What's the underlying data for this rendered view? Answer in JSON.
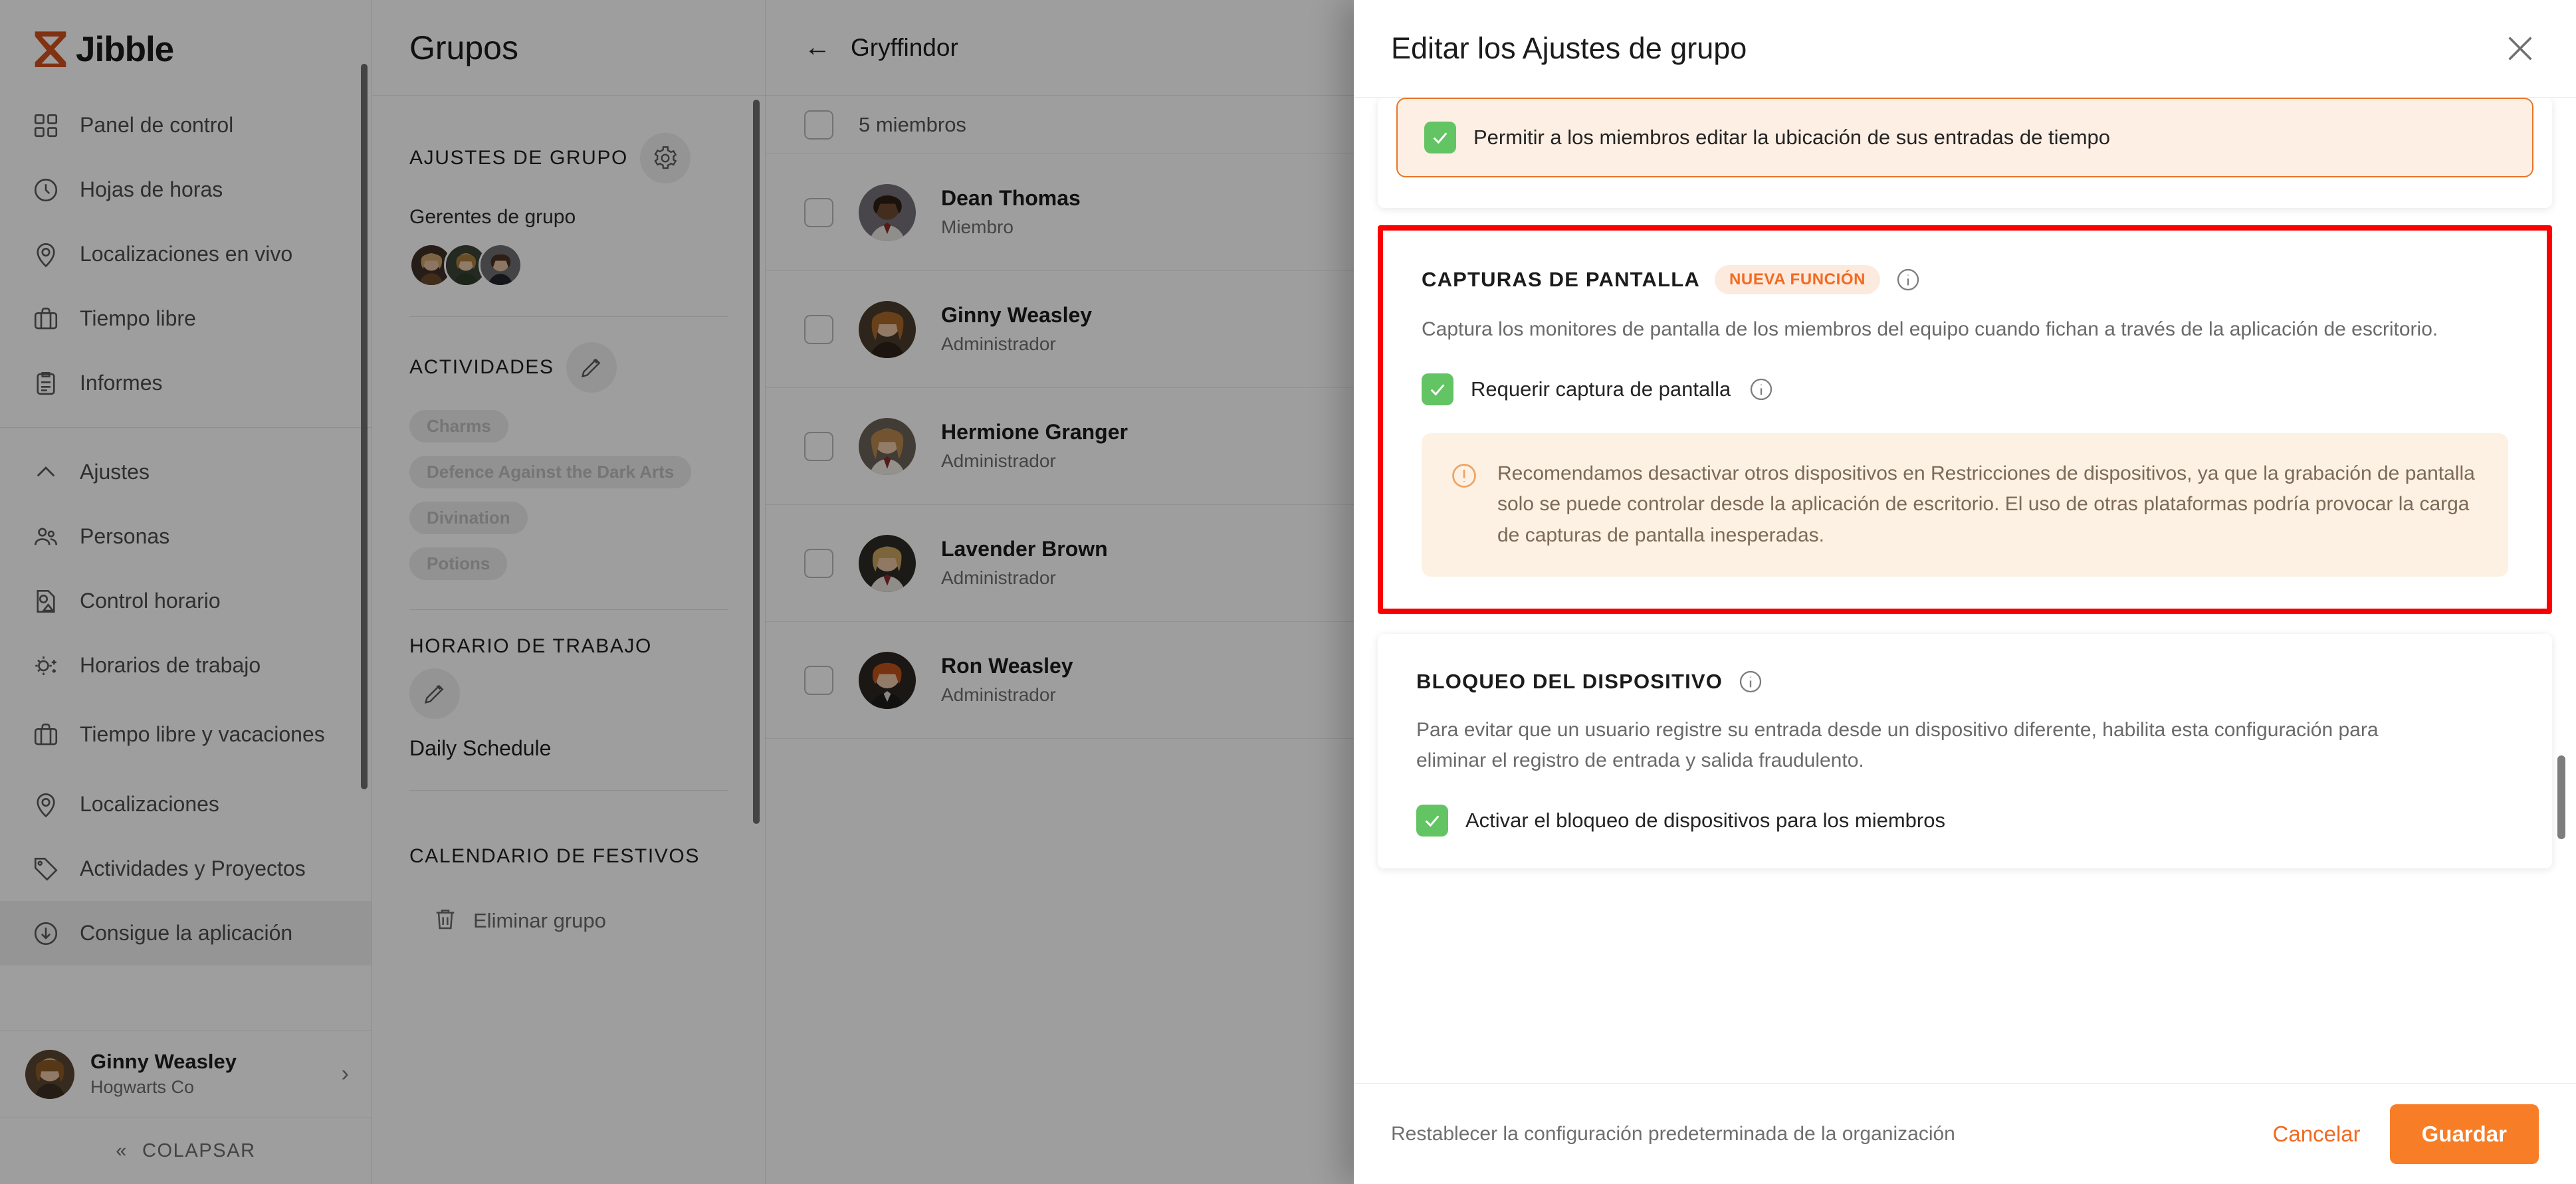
{
  "app": {
    "brand": "Jibble",
    "sidebar": {
      "items": [
        {
          "label": "Panel de control",
          "icon": "dashboard-icon",
          "active": false
        },
        {
          "label": "Hojas de horas",
          "icon": "clock-icon",
          "active": false
        },
        {
          "label": "Localizaciones en vivo",
          "icon": "location-pin-icon",
          "active": false
        },
        {
          "label": "Tiempo libre",
          "icon": "briefcase-icon",
          "active": false
        },
        {
          "label": "Informes",
          "icon": "clipboard-icon",
          "active": false
        }
      ],
      "settings_group": [
        {
          "label": "Ajustes",
          "icon": "chevron-up-icon",
          "active": false
        },
        {
          "label": "Personas",
          "icon": "people-icon",
          "active": false
        },
        {
          "label": "Control horario",
          "icon": "time-control-icon",
          "active": false
        },
        {
          "label": "Horarios de trabajo",
          "icon": "sun-schedule-icon",
          "active": false
        },
        {
          "label": "Tiempo libre y vacaciones",
          "icon": "briefcase-icon",
          "active": false
        },
        {
          "label": "Localizaciones",
          "icon": "location-pin-icon",
          "active": false
        },
        {
          "label": "Actividades y Proyectos",
          "icon": "tag-icon",
          "active": false
        },
        {
          "label": "Consigue la aplicación",
          "icon": "download-icon",
          "active": true
        }
      ],
      "user": {
        "name": "Ginny Weasley",
        "org": "Hogwarts Co"
      },
      "collapse_label": "COLAPSAR"
    },
    "groups_panel": {
      "title": "Grupos",
      "settings_section_title": "AJUSTES DE GRUPO",
      "managers_label": "Gerentes de grupo",
      "managers_count": 3,
      "activities_title": "ACTIVIDADES",
      "activities": [
        "Charms",
        "Defence Against the Dark Arts",
        "Divination",
        "Potions"
      ],
      "schedule_title": "HORARIO DE TRABAJO",
      "schedule_name": "Daily Schedule",
      "holiday_title": "CALENDARIO DE FESTIVOS",
      "delete_label": "Eliminar grupo"
    },
    "members_panel": {
      "group_name": "Gryffindor",
      "count_label": "5 miembros",
      "members": [
        {
          "name": "Dean Thomas",
          "role": "Miembro"
        },
        {
          "name": "Ginny Weasley",
          "role": "Administrador"
        },
        {
          "name": "Hermione Granger",
          "role": "Administrador"
        },
        {
          "name": "Lavender Brown",
          "role": "Administrador"
        },
        {
          "name": "Ron Weasley",
          "role": "Administrador"
        }
      ]
    }
  },
  "modal": {
    "title": "Editar los Ajustes de grupo",
    "close_icon": "close-icon",
    "top_card": {
      "checkbox_label": "Permitir a los miembros editar la ubicación de sus entradas de tiempo",
      "checked": true
    },
    "screenshots_section": {
      "title": "CAPTURAS DE PANTALLA",
      "badge": "NUEVA FUNCIÓN",
      "description": "Captura los monitores de pantalla de los miembros del equipo cuando fichan a través de la aplicación de escritorio.",
      "checkbox_label": "Requerir captura de pantalla",
      "checked": true,
      "note": "Recomendamos desactivar otros dispositivos en Restricciones de dispositivos, ya que la grabación de pantalla solo se puede controlar desde la aplicación de escritorio. El uso de otras plataformas podría provocar la carga de capturas de pantalla inesperadas.",
      "highlighted": true,
      "highlight_color": "#ff0000"
    },
    "device_lock_section": {
      "title": "BLOQUEO DEL DISPOSITIVO",
      "description": "Para evitar que un usuario registre su entrada desde un dispositivo diferente, habilita esta configuración para eliminar el registro de entrada y salida fraudulento.",
      "checkbox_label": "Activar el bloqueo de dispositivos para los miembros",
      "checked": true
    },
    "footer": {
      "reset_label": "Restablecer la configuración predeterminada de la organización",
      "cancel_label": "Cancelar",
      "save_label": "Guardar"
    }
  },
  "colors": {
    "brand_orange": "#f77d26",
    "accent_orange": "#f26a20",
    "checkbox_green": "#62c462",
    "highlight_red": "#ff0000"
  }
}
